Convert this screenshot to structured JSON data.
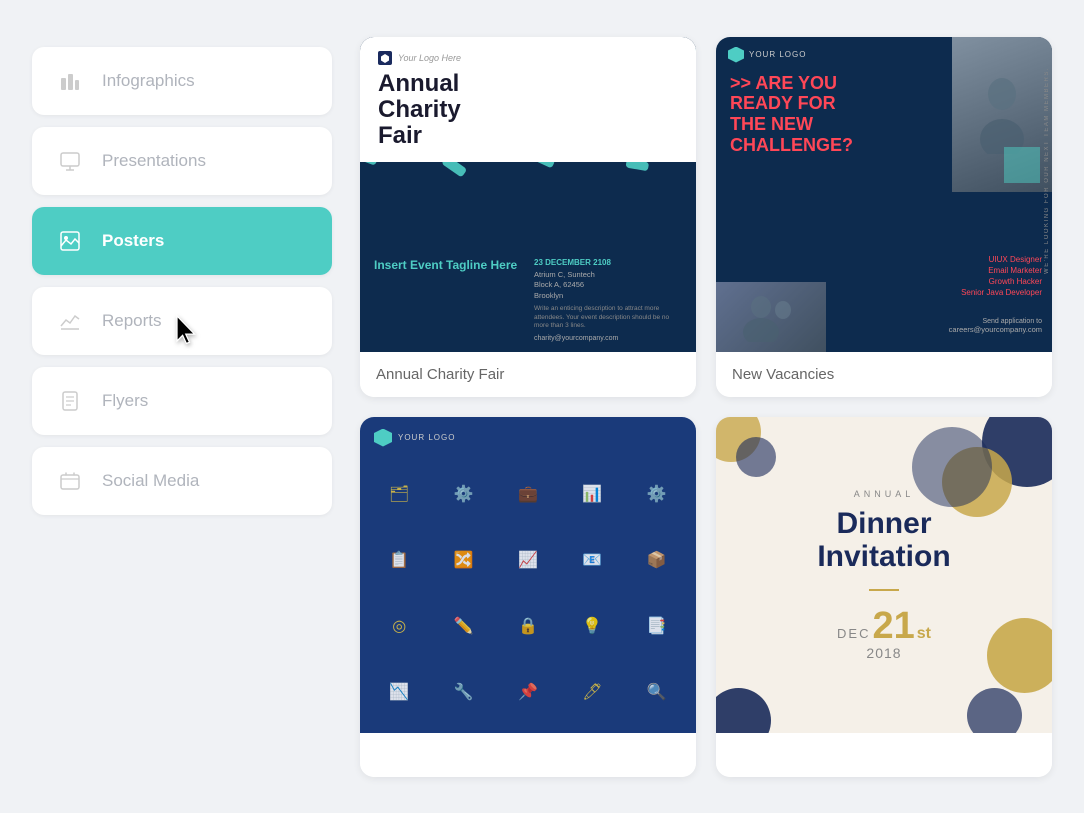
{
  "sidebar": {
    "items": [
      {
        "id": "infographics",
        "label": "Infographics",
        "icon": "📊",
        "active": false
      },
      {
        "id": "presentations",
        "label": "Presentations",
        "icon": "🖥",
        "active": false
      },
      {
        "id": "posters",
        "label": "Posters",
        "icon": "🖼",
        "active": true
      },
      {
        "id": "reports",
        "label": "Reports",
        "icon": "📈",
        "active": false
      },
      {
        "id": "flyers",
        "label": "Flyers",
        "icon": "📄",
        "active": false
      },
      {
        "id": "social-media",
        "label": "Social Media",
        "icon": "📱",
        "active": false
      }
    ]
  },
  "cards": [
    {
      "id": "charity-fair",
      "label": "Annual Charity Fair",
      "preview_type": "charity"
    },
    {
      "id": "new-vacancies",
      "label": "New Vacancies",
      "preview_type": "vacancies"
    },
    {
      "id": "business-icons",
      "label": "",
      "preview_type": "business"
    },
    {
      "id": "dinner-invitation",
      "label": "",
      "preview_type": "dinner"
    }
  ],
  "charity": {
    "logo_text": "Your Logo Here",
    "title": "Annual Charity Fair",
    "tagline": "Insert Event Tagline Here",
    "date": "23 DECEMBER 2108",
    "venue": "Atrium C, Suntech",
    "address": "Block A, 62456\nBrooklyn",
    "description": "Write an enticing description to attract more attendees. Your event description should be no more than 3 lines.",
    "email": "charity@yourcompany.com"
  },
  "vacancies": {
    "logo_text": "YOUR LOGO",
    "headline": ">> ARE YOU READY FOR THE NEW CHALLENGE?",
    "side_text": "WE'RE LOOKING FOR OUR NEXT TEAM MEMBERS.",
    "roles": [
      "UIUX Designer",
      "Email Marketer",
      "Growth Hacker",
      "Senior Java Developer"
    ],
    "apply_text": "Send application to",
    "apply_email": "careers@yourcompany.com"
  },
  "business": {
    "logo_text": "YOUR LOGO"
  },
  "dinner": {
    "annual": "ANNUAL",
    "title": "Dinner\nInvitation",
    "month": "DEC",
    "day": "21",
    "ordinal": "st",
    "year": "2018"
  }
}
